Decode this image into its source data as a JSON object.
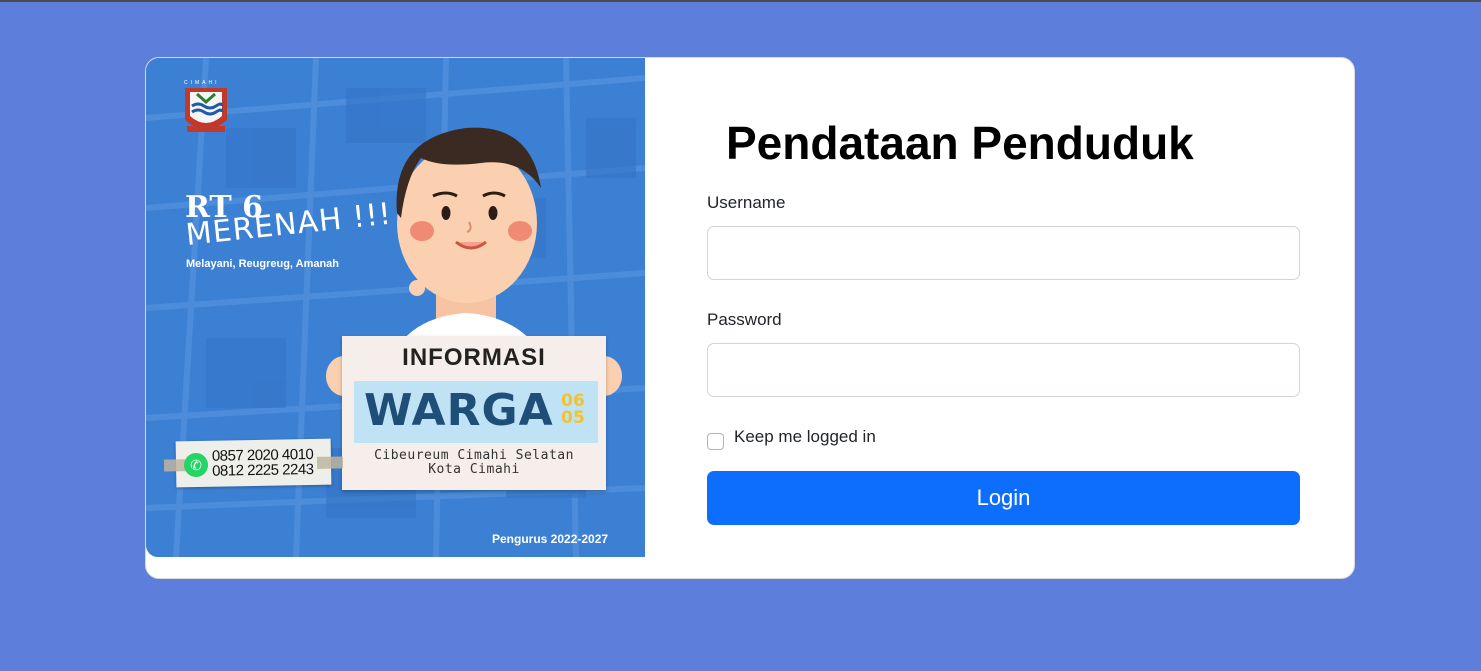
{
  "banner": {
    "logo_caption": "CIMAHI",
    "title": "RT 6",
    "slogan": "MERENAH !!!",
    "tagline": "Melayani, Reugreug, Amanah",
    "sign": {
      "heading": "INFORMASI",
      "main": "WARGA",
      "number_top": "06",
      "number_bottom": "05",
      "address_line1": "Cibeureum Cimahi Selatan",
      "address_line2": "Kota Cimahi"
    },
    "phones": [
      "0857 2020 4010",
      "0812 2225 2243"
    ],
    "footer": "Pengurus 2022-2027",
    "colors": {
      "map_blue": "#3b82d6",
      "sign_band": "#bfe2f4",
      "warga_text": "#1f4e79"
    }
  },
  "form": {
    "title": "Pendataan Penduduk",
    "username_label": "Username",
    "username_value": "",
    "password_label": "Password",
    "password_value": "",
    "remember_label": "Keep me logged in",
    "remember_checked": false,
    "login_label": "Login"
  },
  "theme": {
    "page_background": "#5e7edc",
    "primary": "#0d6efd"
  }
}
